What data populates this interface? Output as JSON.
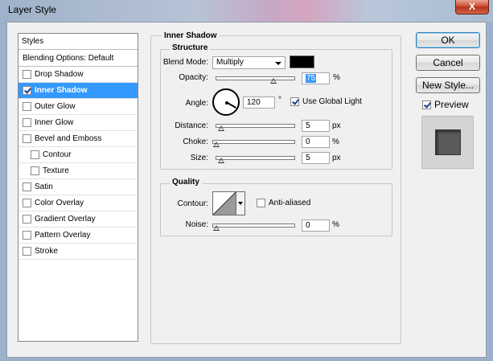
{
  "window": {
    "title": "Layer Style",
    "close_label": "X"
  },
  "styles_panel": {
    "header": "Styles",
    "blending_options": "Blending Options: Default",
    "items": [
      {
        "label": "Drop Shadow",
        "checked": false,
        "selected": false,
        "sub": false
      },
      {
        "label": "Inner Shadow",
        "checked": true,
        "selected": true,
        "sub": false
      },
      {
        "label": "Outer Glow",
        "checked": false,
        "selected": false,
        "sub": false
      },
      {
        "label": "Inner Glow",
        "checked": false,
        "selected": false,
        "sub": false
      },
      {
        "label": "Bevel and Emboss",
        "checked": false,
        "selected": false,
        "sub": false
      },
      {
        "label": "Contour",
        "checked": false,
        "selected": false,
        "sub": true
      },
      {
        "label": "Texture",
        "checked": false,
        "selected": false,
        "sub": true
      },
      {
        "label": "Satin",
        "checked": false,
        "selected": false,
        "sub": false
      },
      {
        "label": "Color Overlay",
        "checked": false,
        "selected": false,
        "sub": false
      },
      {
        "label": "Gradient Overlay",
        "checked": false,
        "selected": false,
        "sub": false
      },
      {
        "label": "Pattern Overlay",
        "checked": false,
        "selected": false,
        "sub": false
      },
      {
        "label": "Stroke",
        "checked": false,
        "selected": false,
        "sub": false
      }
    ]
  },
  "inner_shadow": {
    "group_title": "Inner Shadow",
    "structure": {
      "title": "Structure",
      "blend_mode_label": "Blend Mode:",
      "blend_mode_value": "Multiply",
      "shadow_color": "#000000",
      "opacity_label": "Opacity:",
      "opacity_value": "75",
      "opacity_unit": "%",
      "opacity_level": 0.75,
      "angle_label": "Angle:",
      "angle_value": "120",
      "angle_unit": "°",
      "global_light_label": "Use Global Light",
      "global_light_checked": true,
      "distance_label": "Distance:",
      "distance_value": "5",
      "distance_unit": "px",
      "distance_level": 0.02,
      "choke_label": "Choke:",
      "choke_value": "0",
      "choke_unit": "%",
      "choke_level": 0,
      "size_label": "Size:",
      "size_value": "5",
      "size_unit": "px",
      "size_level": 0.02
    },
    "quality": {
      "title": "Quality",
      "contour_label": "Contour:",
      "anti_aliased_label": "Anti-aliased",
      "anti_aliased_checked": false,
      "noise_label": "Noise:",
      "noise_value": "0",
      "noise_unit": "%",
      "noise_level": 0
    }
  },
  "buttons": {
    "ok": "OK",
    "cancel": "Cancel",
    "new_style": "New Style...",
    "preview_label": "Preview",
    "preview_checked": true
  }
}
